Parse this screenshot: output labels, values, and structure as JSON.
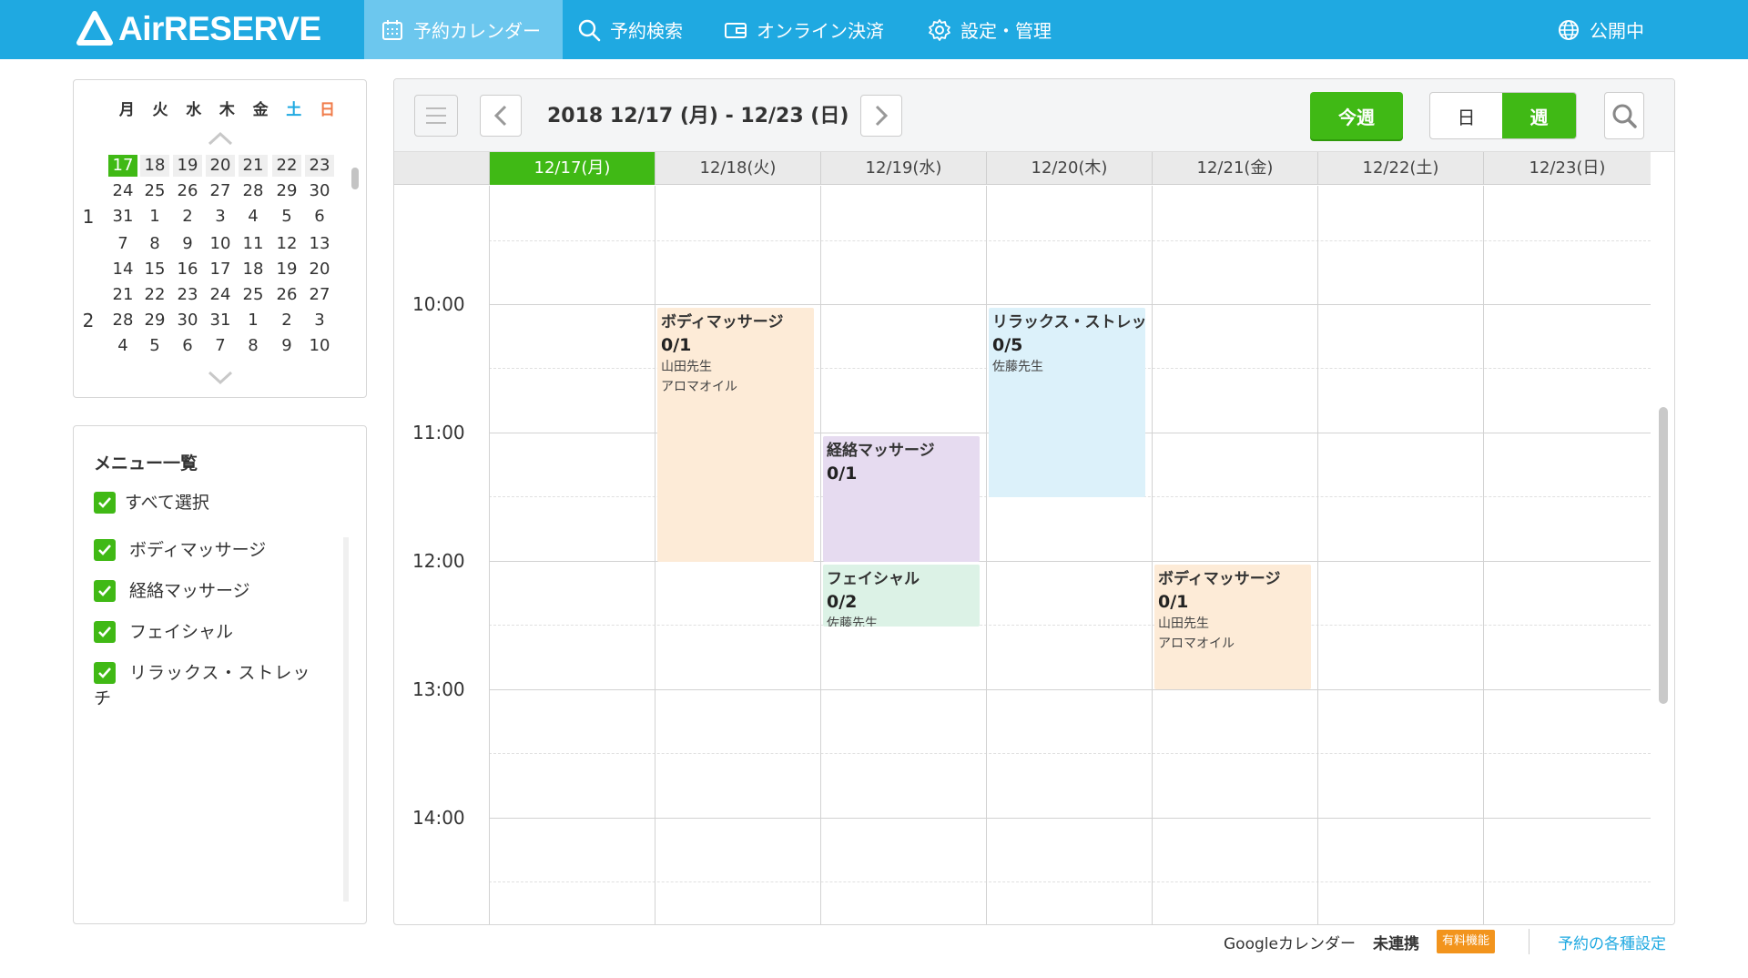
{
  "topnav": {
    "logo": "AirRESERVE",
    "items": [
      {
        "label": "予約カレンダー",
        "icon": "calendar-icon",
        "active": true
      },
      {
        "label": "予約検索",
        "icon": "search-icon"
      },
      {
        "label": "オンライン決済",
        "icon": "wallet-icon"
      },
      {
        "label": "設定・管理",
        "icon": "gear-icon"
      }
    ],
    "status": "公開中"
  },
  "minicalendar": {
    "weekdays": [
      "月",
      "火",
      "水",
      "木",
      "金",
      "土",
      "日"
    ],
    "months": [
      "1",
      "2"
    ],
    "rows": [
      [
        "17",
        "18",
        "19",
        "20",
        "21",
        "22",
        "23"
      ],
      [
        "24",
        "25",
        "26",
        "27",
        "28",
        "29",
        "30"
      ],
      [
        "31",
        "1",
        "2",
        "3",
        "4",
        "5",
        "6"
      ],
      [
        "7",
        "8",
        "9",
        "10",
        "11",
        "12",
        "13"
      ],
      [
        "14",
        "15",
        "16",
        "17",
        "18",
        "19",
        "20"
      ],
      [
        "21",
        "22",
        "23",
        "24",
        "25",
        "26",
        "27"
      ],
      [
        "28",
        "29",
        "30",
        "31",
        "1",
        "2",
        "3"
      ],
      [
        "4",
        "5",
        "6",
        "7",
        "8",
        "9",
        "10"
      ]
    ],
    "selected_day": "17"
  },
  "menu": {
    "title": "メニュー一覧",
    "select_all": "すべて選択",
    "items": [
      "ボディマッサージ",
      "経絡マッサージ",
      "フェイシャル",
      "リラックス・ストレッチ"
    ]
  },
  "toolbar": {
    "range": "2018 12/17 (月) - 12/23 (日)",
    "this_week": "今週",
    "day": "日",
    "week": "週"
  },
  "days": [
    "12/17(月)",
    "12/18(火)",
    "12/19(水)",
    "12/20(木)",
    "12/21(金)",
    "12/22(土)",
    "12/23(日)"
  ],
  "times": [
    "10:00",
    "11:00",
    "12:00",
    "13:00",
    "14:00"
  ],
  "events": [
    {
      "name": "ボディマッサージ",
      "count": "0/1",
      "teacher": "山田先生",
      "note": "アロマオイル",
      "color": "#fdebd7"
    },
    {
      "name": "リラックス・ストレッチ",
      "count": "0/5",
      "teacher": "佐藤先生",
      "color": "#dcf1fa"
    },
    {
      "name": "経絡マッサージ",
      "count": "0/1",
      "color": "#e6dbf0"
    },
    {
      "name": "フェイシャル",
      "count": "0/2",
      "teacher": "佐藤先生",
      "color": "#dcf2e6"
    },
    {
      "name": "ボディマッサージ",
      "count": "0/1",
      "teacher": "山田先生",
      "note": "アロマオイル",
      "color": "#fdebd7"
    }
  ],
  "footer": {
    "gcal": "Googleカレンダー",
    "status": "未連携",
    "paid": "有料機能",
    "settings": "予約の各種設定"
  },
  "colors": {
    "brand": "#1fa9e1",
    "accent": "#40b915",
    "paid": "#f2941d"
  }
}
